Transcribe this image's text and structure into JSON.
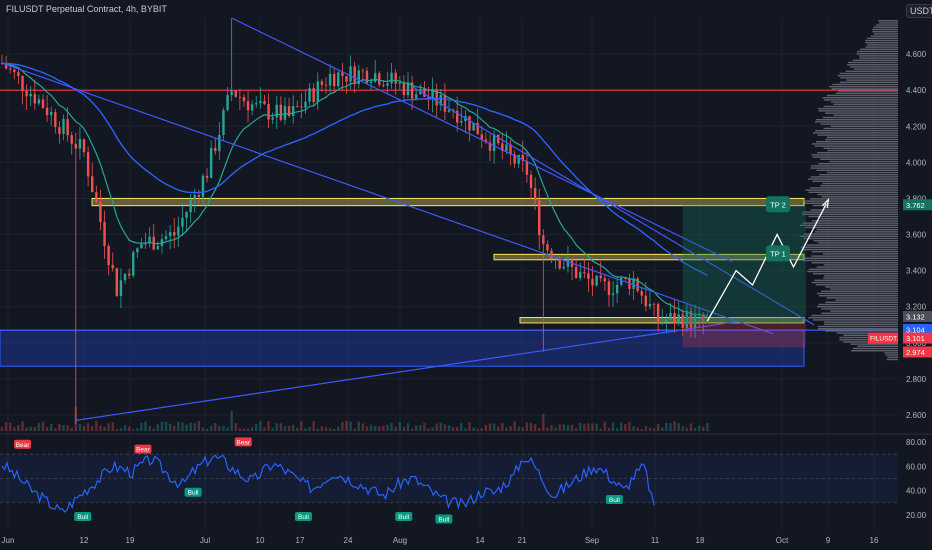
{
  "header": {
    "title": "FILUSDT Perpetual Contract, 4h, BYBIT",
    "unit": "USDT"
  },
  "colors": {
    "background": "#131722",
    "candle_up": "#26a69a",
    "candle_down": "#ef5350",
    "ema_fast": "#26a69a",
    "ema_slow": "#2962ff",
    "trendline": "#3d5afe",
    "resistance_line": "#f23645",
    "zone_yellow": "#f5e663",
    "zone_blue": "#1e3fa8",
    "rsi": "#2962ff",
    "tp": "#14735f"
  },
  "chart_data": [
    {
      "type": "candlestick",
      "title": "FILUSDT Perpetual Contract, 4h, BYBIT",
      "ylabel": "USDT",
      "ylim": [
        2.5,
        4.8
      ],
      "y_ticks": [
        2.6,
        2.8,
        3.0,
        3.2,
        3.4,
        3.6,
        3.8,
        4.0,
        4.2,
        4.4,
        4.6
      ],
      "y_tick_labels": [
        "2.600",
        "2.800",
        "3.000",
        "3.200",
        "3.400",
        "3.600",
        "3.800",
        "4.000",
        "4.200",
        "4.400",
        "4.600"
      ],
      "x_tick_labels": [
        "Jun",
        "12",
        "19",
        "Jul",
        "10",
        "17",
        "24",
        "Aug",
        "14",
        "21",
        "Sep",
        "11",
        "18",
        "Oct",
        "9",
        "16"
      ],
      "price_path": [
        {
          "x": 0,
          "y": 4.55
        },
        {
          "x": 10,
          "y": 4.32
        },
        {
          "x": 20,
          "y": 4.05
        },
        {
          "x": 28,
          "y": 3.3
        },
        {
          "x": 34,
          "y": 3.55
        },
        {
          "x": 42,
          "y": 3.6
        },
        {
          "x": 50,
          "y": 3.95
        },
        {
          "x": 56,
          "y": 4.4
        },
        {
          "x": 62,
          "y": 4.3
        },
        {
          "x": 70,
          "y": 4.25
        },
        {
          "x": 80,
          "y": 4.48
        },
        {
          "x": 90,
          "y": 4.5
        },
        {
          "x": 100,
          "y": 4.4
        },
        {
          "x": 110,
          "y": 4.3
        },
        {
          "x": 120,
          "y": 4.1
        },
        {
          "x": 128,
          "y": 3.95
        },
        {
          "x": 132,
          "y": 3.55
        },
        {
          "x": 138,
          "y": 3.42
        },
        {
          "x": 146,
          "y": 3.3
        },
        {
          "x": 154,
          "y": 3.35
        },
        {
          "x": 160,
          "y": 3.12
        },
        {
          "x": 166,
          "y": 3.14
        },
        {
          "x": 172,
          "y": 3.1
        }
      ],
      "wick_extremes": [
        {
          "x": 18,
          "y": 2.55
        },
        {
          "x": 56,
          "y": 4.8
        },
        {
          "x": 132,
          "y": 2.95
        }
      ],
      "horizontal_levels": [
        {
          "name": "resistance",
          "value": 4.4
        },
        {
          "name": "support",
          "value": 3.07
        }
      ],
      "zones": [
        {
          "name": "upper-yellow-zone",
          "from": 3.76,
          "to": 3.8
        },
        {
          "name": "mid-yellow-zone",
          "from": 3.46,
          "to": 3.49
        },
        {
          "name": "low-yellow-zone",
          "from": 3.11,
          "to": 3.14
        },
        {
          "name": "blue-demand-zone",
          "from": 2.87,
          "to": 3.07
        }
      ],
      "trade_setup": {
        "entry": 3.104,
        "tp1": 3.49,
        "tp2": 3.762,
        "stop": 2.974,
        "tp1_label": "TP 1",
        "tp2_label": "TP 2"
      },
      "projection": [
        {
          "x": 172,
          "y": 3.12
        },
        {
          "x": 179,
          "y": 3.4
        },
        {
          "x": 183,
          "y": 3.32
        },
        {
          "x": 189,
          "y": 3.6
        },
        {
          "x": 193,
          "y": 3.42
        },
        {
          "x": 201,
          "y": 3.77
        }
      ],
      "price_labels": [
        {
          "text": "3.762",
          "value": 3.762,
          "color": "#14735f"
        },
        {
          "text": "3.132",
          "value": 3.132,
          "color": "#4d4f58"
        },
        {
          "text": "3.104",
          "value": 3.104,
          "color": "#2962ff"
        },
        {
          "text": "3.101",
          "value": 3.101,
          "color": "#f23645"
        },
        {
          "text": "2.974",
          "value": 2.974,
          "color": "#f23645"
        }
      ],
      "last_price_tag": "FILUSDT.P"
    },
    {
      "type": "line",
      "title": "",
      "ylim": [
        10,
        85
      ],
      "y_ticks": [
        20,
        40,
        60,
        80
      ],
      "y_tick_labels": [
        "20.00",
        "40.00",
        "60.00",
        "80.00"
      ],
      "values": [
        62,
        55,
        48,
        40,
        34,
        28,
        22,
        30,
        38,
        45,
        52,
        60,
        58,
        55,
        62,
        66,
        58,
        50,
        45,
        55,
        62,
        68,
        65,
        58,
        52,
        48,
        56,
        62,
        58,
        52,
        46,
        42,
        48,
        55,
        52,
        48,
        44,
        40,
        36,
        42,
        48,
        50,
        44,
        38,
        32,
        30,
        28,
        34,
        40,
        38,
        45,
        52,
        68,
        62,
        48,
        36,
        42,
        48,
        54,
        60,
        56,
        48,
        40,
        52,
        60,
        28
      ],
      "signals": [
        {
          "label": "Bear",
          "index": 2,
          "value": 72
        },
        {
          "label": "Bull",
          "index": 8,
          "value": 24
        },
        {
          "label": "Bear",
          "index": 14,
          "value": 68
        },
        {
          "label": "Bull",
          "index": 19,
          "value": 44
        },
        {
          "label": "Bear",
          "index": 24,
          "value": 74
        },
        {
          "label": "Bull",
          "index": 30,
          "value": 24
        },
        {
          "label": "Bull",
          "index": 40,
          "value": 24
        },
        {
          "label": "Bull",
          "index": 44,
          "value": 22
        },
        {
          "label": "Bull",
          "index": 61,
          "value": 38
        }
      ]
    }
  ]
}
